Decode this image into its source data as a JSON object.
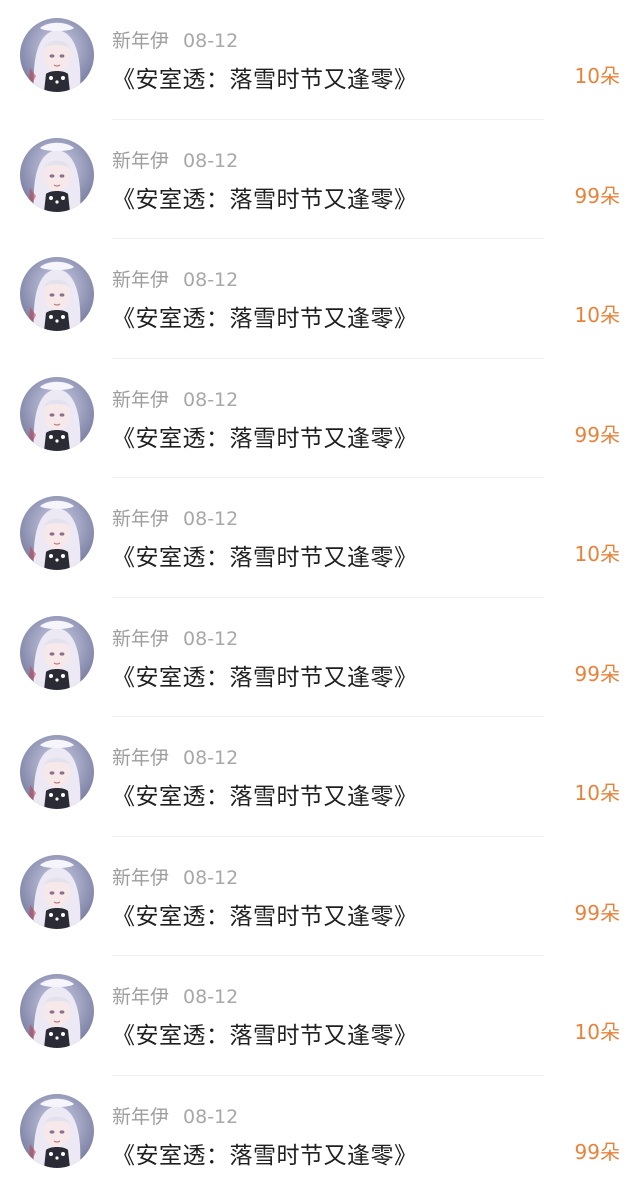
{
  "colors": {
    "amount": "#e8823a",
    "meta": "#9e9e9e",
    "title": "#1f1f1f",
    "divider": "#f1f1f1"
  },
  "items": [
    {
      "name": "新年伊",
      "date": "08-12",
      "title": "《安室透：落雪时节又逢零》",
      "amount": "10朵"
    },
    {
      "name": "新年伊",
      "date": "08-12",
      "title": "《安室透：落雪时节又逢零》",
      "amount": "99朵"
    },
    {
      "name": "新年伊",
      "date": "08-12",
      "title": "《安室透：落雪时节又逢零》",
      "amount": "10朵"
    },
    {
      "name": "新年伊",
      "date": "08-12",
      "title": "《安室透：落雪时节又逢零》",
      "amount": "99朵"
    },
    {
      "name": "新年伊",
      "date": "08-12",
      "title": "《安室透：落雪时节又逢零》",
      "amount": "10朵"
    },
    {
      "name": "新年伊",
      "date": "08-12",
      "title": "《安室透：落雪时节又逢零》",
      "amount": "99朵"
    },
    {
      "name": "新年伊",
      "date": "08-12",
      "title": "《安室透：落雪时节又逢零》",
      "amount": "10朵"
    },
    {
      "name": "新年伊",
      "date": "08-12",
      "title": "《安室透：落雪时节又逢零》",
      "amount": "99朵"
    },
    {
      "name": "新年伊",
      "date": "08-12",
      "title": "《安室透：落雪时节又逢零》",
      "amount": "10朵"
    },
    {
      "name": "新年伊",
      "date": "08-12",
      "title": "《安室透：落雪时节又逢零》",
      "amount": "99朵"
    }
  ]
}
